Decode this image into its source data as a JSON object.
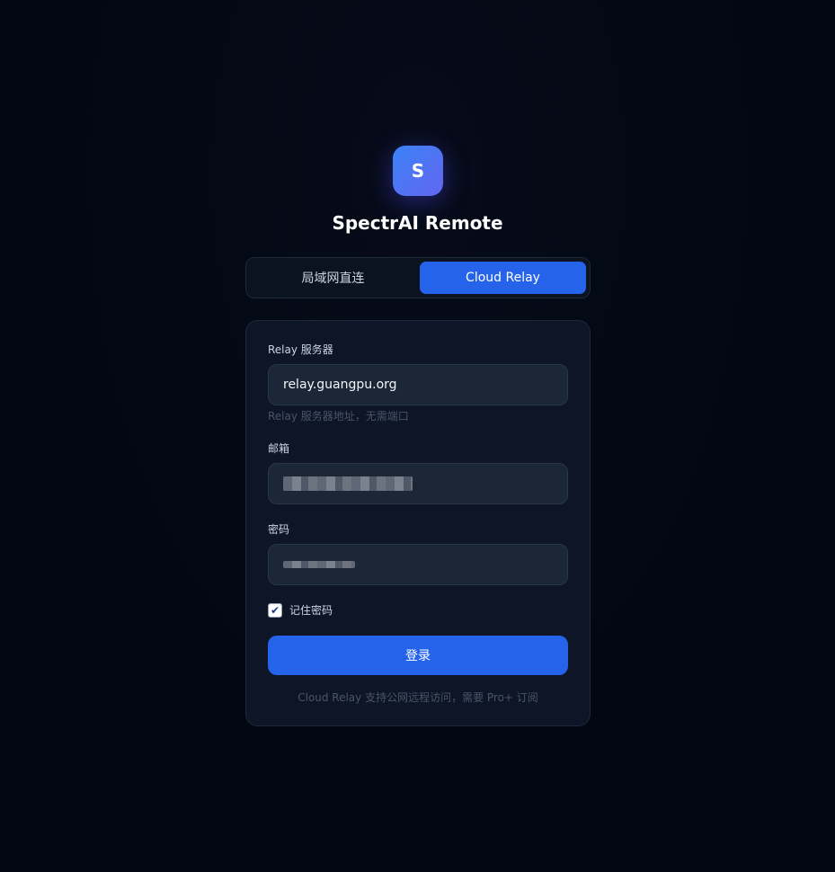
{
  "logo": {
    "letter": "S"
  },
  "app_title": "SpectrAI Remote",
  "mode_tabs": [
    {
      "label": "局域网直连",
      "active": false
    },
    {
      "label": "Cloud Relay",
      "active": true
    }
  ],
  "form": {
    "relay_label": "Relay 服务器",
    "relay_value": "relay.guangpu.org",
    "relay_hint": "Relay 服务器地址，无需端口",
    "email_label": "邮箱",
    "password_label": "密码",
    "remember_label": "记住密码",
    "remember_checked": true,
    "login_label": "登录",
    "footer_note": "Cloud Relay 支持公网远程访问，需要 Pro+ 订阅"
  },
  "colors": {
    "accent": "#2563eb",
    "background": "#030712",
    "card": "#0d1526"
  }
}
